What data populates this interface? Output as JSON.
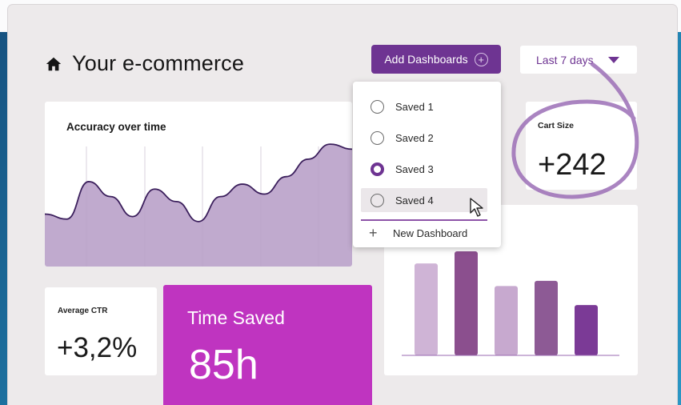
{
  "header": {
    "title": "Your e-commerce",
    "icon": "home-icon",
    "add_dashboards_label": "Add Dashboards",
    "date_range": "Last 7 days"
  },
  "dropdown": {
    "items": [
      {
        "label": "Saved 1",
        "selected": false
      },
      {
        "label": "Saved 2",
        "selected": false
      },
      {
        "label": "Saved 3",
        "selected": true
      },
      {
        "label": "Saved 4",
        "selected": false,
        "hovered": true
      }
    ],
    "new_label": "New Dashboard"
  },
  "cards": {
    "accuracy": {
      "label": "Accuracy over time"
    },
    "cart_size": {
      "label": "Cart Size",
      "value": "+242"
    },
    "ctr": {
      "label": "Average CTR",
      "value": "+3,2%"
    },
    "time_saved": {
      "label": "Time Saved",
      "value": "85h"
    }
  },
  "colors": {
    "accent": "#6e3492",
    "magenta": "#bf34c0",
    "area_fill": "#b9a1c9",
    "bar_colors": [
      "#cfb4d6",
      "#8b4f8e",
      "#c7a9cf",
      "#8d5a95",
      "#7b3a96"
    ]
  },
  "chart_data": [
    {
      "type": "area",
      "title": "Accuracy over time",
      "x": [
        0,
        1,
        2,
        3,
        4,
        5,
        6,
        7,
        8,
        9,
        10,
        11,
        12,
        13,
        14
      ],
      "values": [
        42,
        38,
        68,
        56,
        40,
        62,
        52,
        36,
        56,
        66,
        58,
        72,
        86,
        98,
        94
      ],
      "grid": true
    },
    {
      "type": "bar",
      "values": [
        5.3,
        6.0,
        4.0,
        4.3,
        2.9
      ]
    }
  ]
}
